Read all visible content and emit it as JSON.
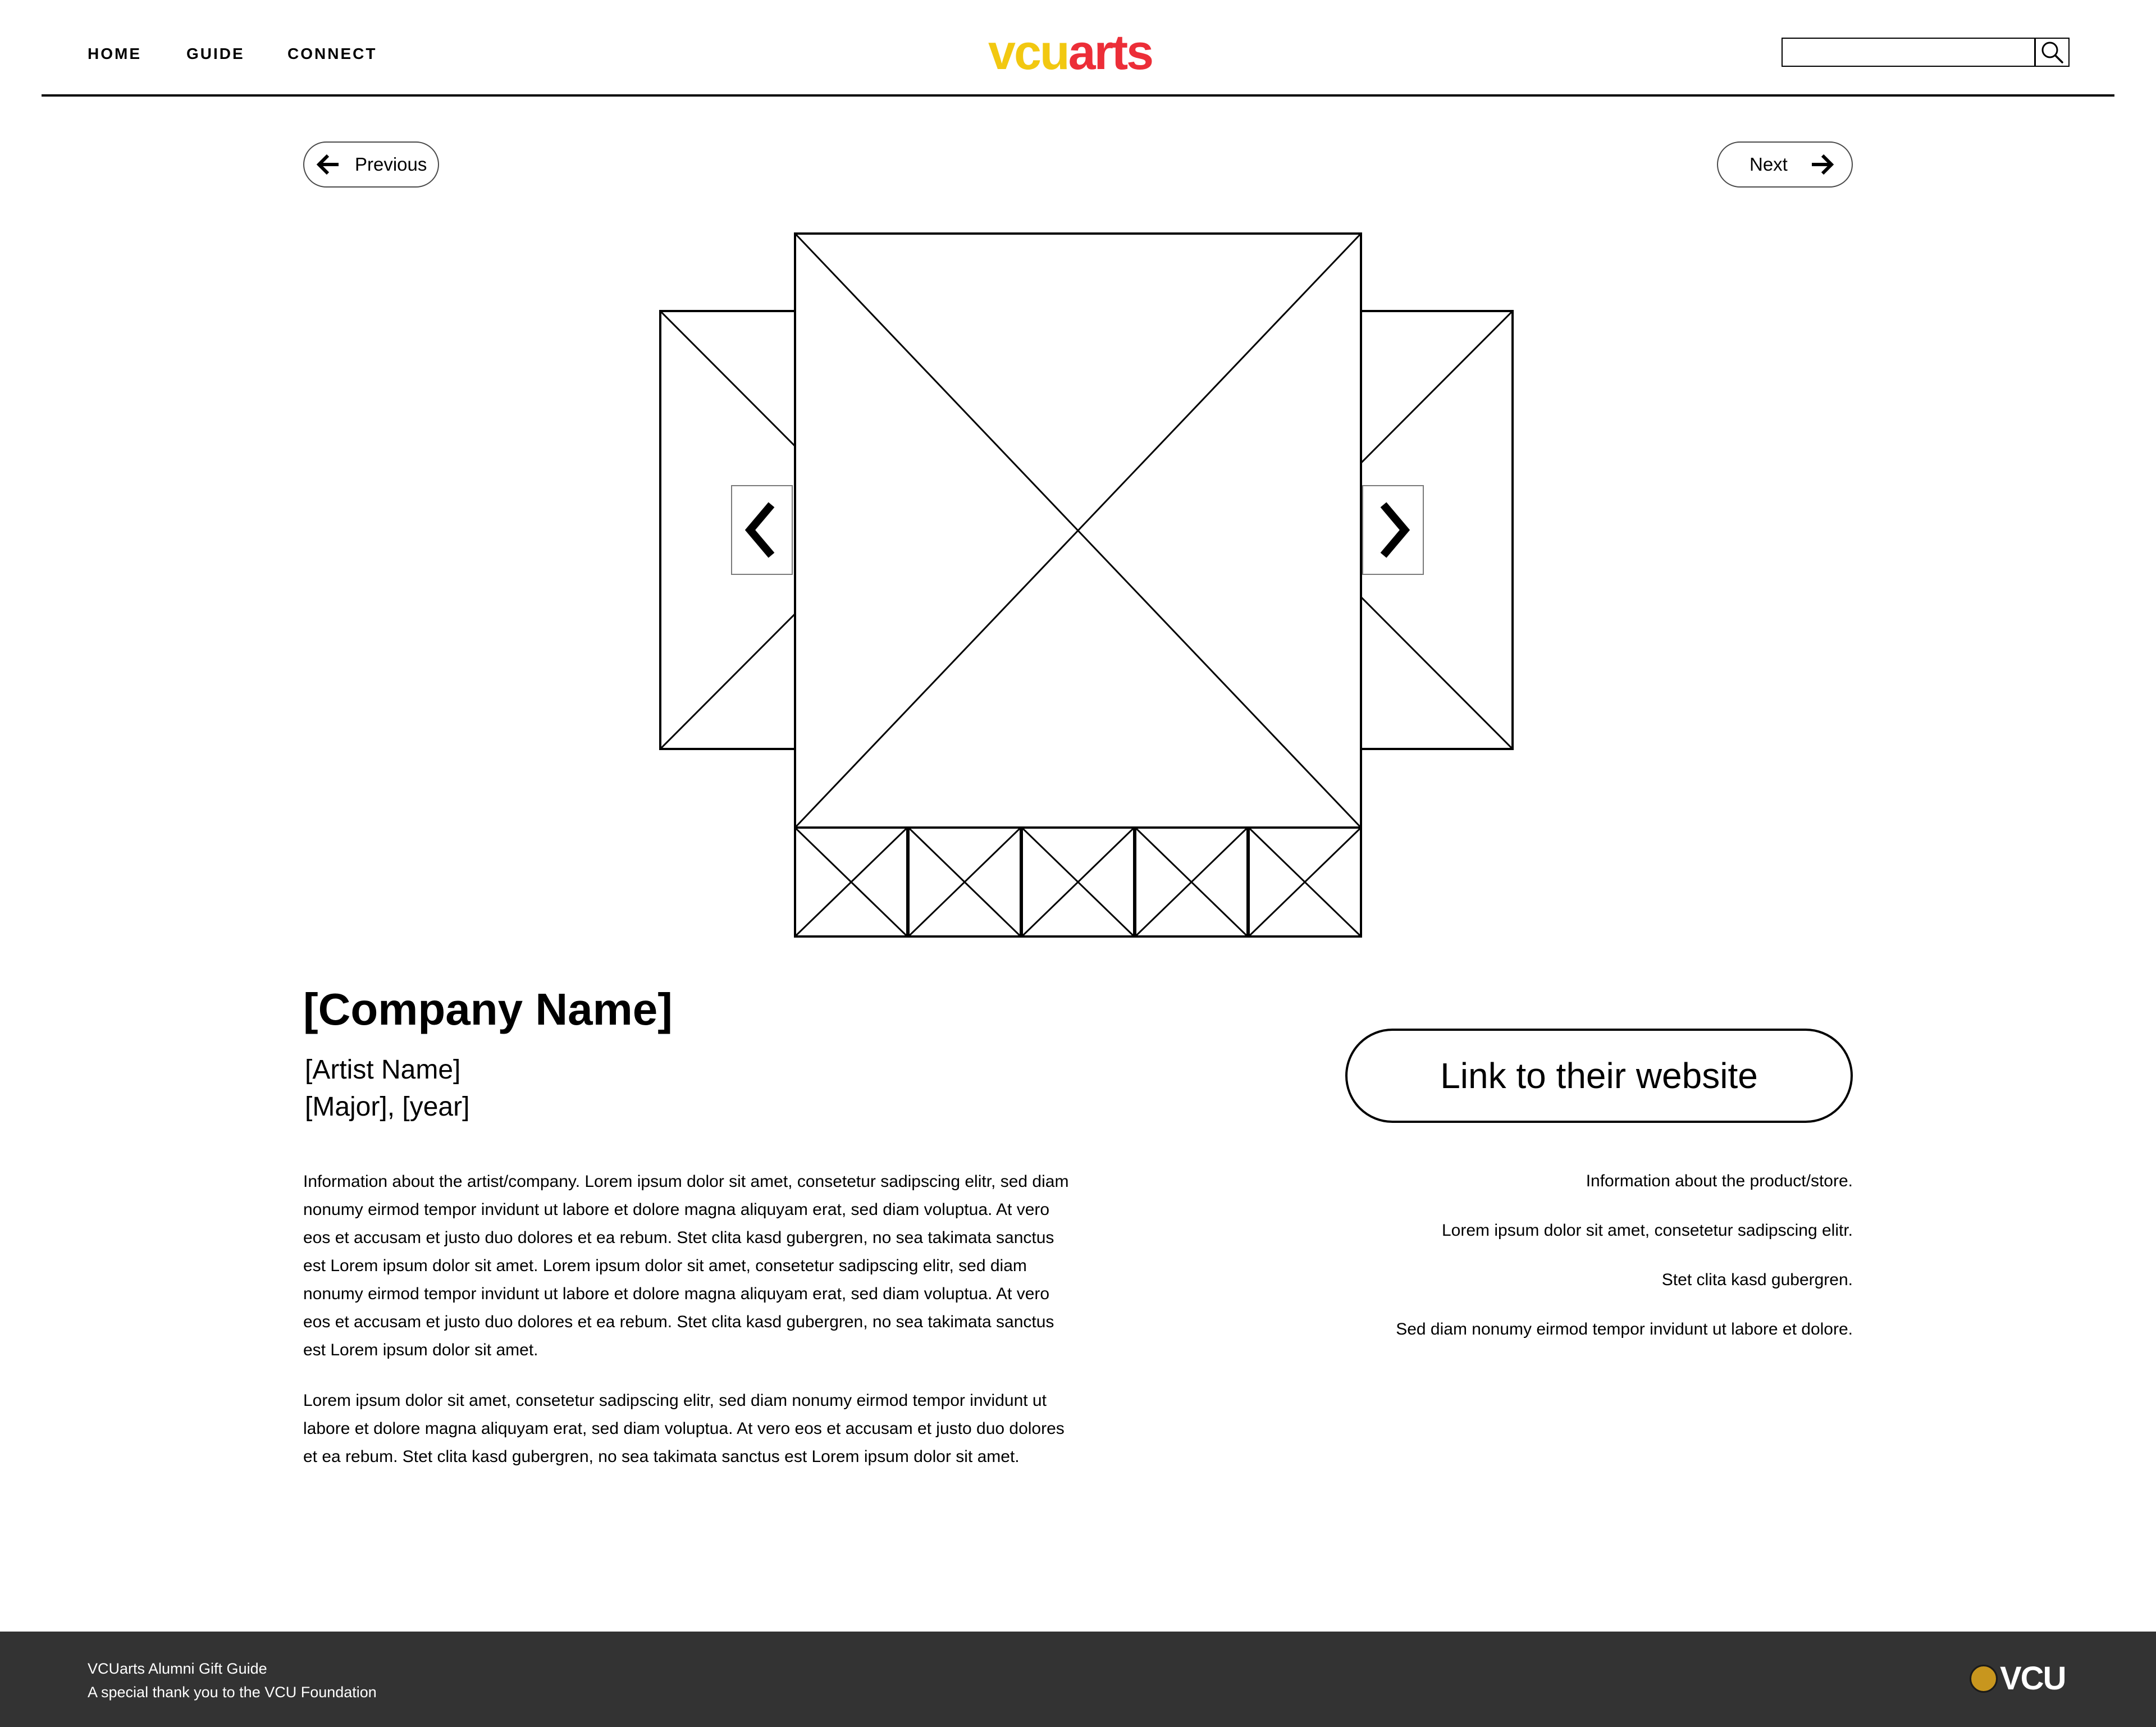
{
  "header": {
    "nav": [
      {
        "label": "HOME"
      },
      {
        "label": "GUIDE"
      },
      {
        "label": "CONNECT"
      }
    ],
    "logo": {
      "part1": "vcu",
      "part2": "arts",
      "part1_color": "#f2c811",
      "part2_color": "#ec2e38"
    },
    "search": {
      "value": "",
      "placeholder": "",
      "icon": "search-icon"
    }
  },
  "pager": {
    "previous_label": "Previous",
    "previous_icon": "arrow-left-icon",
    "next_label": "Next",
    "next_icon": "arrow-right-icon"
  },
  "gallery": {
    "main_image": "image-placeholder",
    "prev_icon": "chevron-left-icon",
    "next_icon": "chevron-right-icon",
    "thumbnail_count": 5
  },
  "details": {
    "company_name": "[Company Name]",
    "artist_name": "[Artist Name]",
    "major_year": "[Major], [year]",
    "paragraphs": [
      "Information about the artist/company. Lorem ipsum dolor sit amet, consetetur sadipscing elitr, sed diam nonumy eirmod tempor invidunt ut labore et dolore magna aliquyam erat, sed diam voluptua. At vero eos et accusam et justo duo dolores et ea rebum. Stet clita kasd gubergren, no sea takimata sanctus est Lorem ipsum dolor sit amet. Lorem ipsum dolor sit amet, consetetur sadipscing elitr, sed diam nonumy eirmod tempor invidunt ut labore et dolore magna aliquyam erat, sed diam voluptua. At vero eos et accusam et justo duo dolores et ea rebum. Stet clita kasd gubergren, no sea takimata sanctus est Lorem ipsum dolor sit amet.",
      "Lorem ipsum dolor sit amet, consetetur sadipscing elitr, sed diam nonumy eirmod tempor invidunt ut labore et dolore magna aliquyam erat, sed diam voluptua. At vero eos et accusam et justo duo dolores et ea rebum. Stet clita kasd gubergren, no sea takimata sanctus est Lorem ipsum dolor sit amet."
    ],
    "website_button": "Link to their website",
    "product_info": [
      "Information about the product/store.",
      "Lorem ipsum dolor sit amet, consetetur sadipscing elitr.",
      "Stet clita kasd gubergren.",
      "Sed diam nonumy eirmod tempor invidunt ut labore et dolore."
    ]
  },
  "footer": {
    "line1": "VCUarts Alumni Gift Guide",
    "line2": "A special thank you to the VCU Foundation",
    "logo_text": "VCU",
    "background": "#333333"
  }
}
